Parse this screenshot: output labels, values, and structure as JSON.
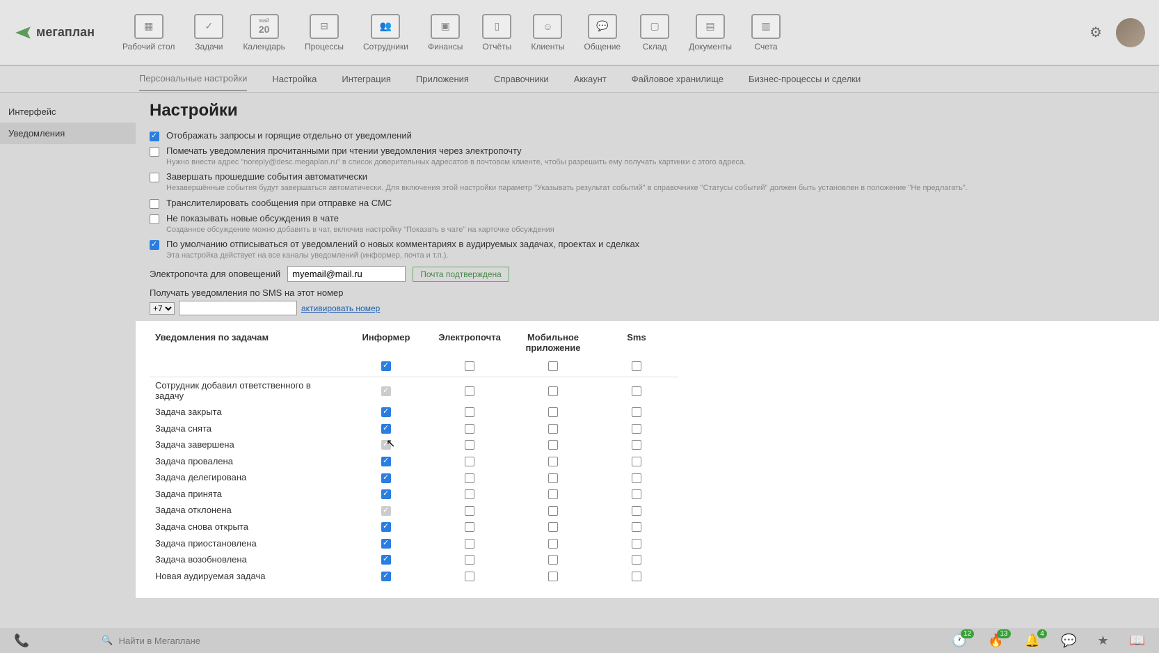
{
  "logo": "мегаплан",
  "nav": [
    {
      "label": "Рабочий стол",
      "icon": "dashboard"
    },
    {
      "label": "Задачи",
      "icon": "check"
    },
    {
      "label": "Календарь",
      "icon": "calendar",
      "num": "20",
      "sub": "май"
    },
    {
      "label": "Процессы",
      "icon": "flow"
    },
    {
      "label": "Сотрудники",
      "icon": "people"
    },
    {
      "label": "Финансы",
      "icon": "safe"
    },
    {
      "label": "Отчёты",
      "icon": "chart"
    },
    {
      "label": "Клиенты",
      "icon": "client"
    },
    {
      "label": "Общение",
      "icon": "chat"
    },
    {
      "label": "Склад",
      "icon": "box"
    },
    {
      "label": "Документы",
      "icon": "docs"
    },
    {
      "label": "Счета",
      "icon": "invoice"
    }
  ],
  "subnav": [
    "Персональные настройки",
    "Настройка",
    "Интеграция",
    "Приложения",
    "Справочники",
    "Аккаунт",
    "Файловое хранилище",
    "Бизнес-процессы и сделки"
  ],
  "subnav_active": 0,
  "sidebar": [
    "Интерфейс",
    "Уведомления"
  ],
  "sidebar_active": 1,
  "title": "Настройки",
  "opts": [
    {
      "checked": true,
      "label": "Отображать запросы и горящие отдельно от уведомлений"
    },
    {
      "checked": false,
      "label": "Помечать уведомления прочитанными при чтении уведомления через электропочту",
      "help": "Нужно внести адрес \"noreply@desc.megaplan.ru\" в список доверительных адресатов в почтовом клиенте, чтобы разрешить ему получать картинки с этого адреса."
    },
    {
      "checked": false,
      "disabled": true,
      "label": "Завершать прошедшие события автоматически",
      "help": "Незавершённые события будут завершаться автоматически.\nДля включения этой настройки параметр \"Указывать результат событий\" в справочнике \"Статусы событий\" должен быть установлен в положение \"Не предлагать\"."
    },
    {
      "checked": false,
      "label": "Транслителировать сообщения при отправке на СМС"
    },
    {
      "checked": false,
      "label": "Не показывать новые обсуждения в чате",
      "help": "Созданное обсуждение можно добавить в чат, включив настройку \"Показать в чате\" на карточке обсуждения"
    },
    {
      "checked": true,
      "label": "По умолчанию отписываться от уведомлений о новых комментариях в аудируемых задачах, проектах и сделках",
      "help": "Эта настройка действует на все каналы уведомлений (информер, почта и т.п.)."
    }
  ],
  "email_label": "Электропочта для оповещений",
  "email_value": "myemail@mail.ru",
  "email_badge": "Почта подтверждена",
  "sms_label": "Получать уведомления по SMS на этот номер",
  "sms_code": "+7",
  "sms_value": "",
  "sms_link": "активировать номер",
  "table": {
    "title": "Уведомления по задачам",
    "cols": [
      "Информер",
      "Электропочта",
      "Мобильное приложение",
      "Sms"
    ],
    "all": [
      true,
      false,
      false,
      false
    ],
    "rows": [
      {
        "label": "Сотрудник добавил ответственного в задачу",
        "cells": [
          "disabled",
          false,
          false,
          false
        ]
      },
      {
        "label": "Задача закрыта",
        "cells": [
          true,
          false,
          false,
          false
        ]
      },
      {
        "label": "Задача снята",
        "cells": [
          true,
          false,
          false,
          false
        ]
      },
      {
        "label": "Задача завершена",
        "cells": [
          "disabled",
          false,
          false,
          false
        ]
      },
      {
        "label": "Задача провалена",
        "cells": [
          true,
          false,
          false,
          false
        ]
      },
      {
        "label": "Задача делегирована",
        "cells": [
          true,
          false,
          false,
          false
        ]
      },
      {
        "label": "Задача принята",
        "cells": [
          true,
          false,
          false,
          false
        ]
      },
      {
        "label": "Задача отклонена",
        "cells": [
          "disabled",
          false,
          false,
          false
        ]
      },
      {
        "label": "Задача снова открыта",
        "cells": [
          true,
          false,
          false,
          false
        ]
      },
      {
        "label": "Задача приостановлена",
        "cells": [
          true,
          false,
          false,
          false
        ]
      },
      {
        "label": "Задача возобновлена",
        "cells": [
          true,
          false,
          false,
          false
        ]
      },
      {
        "label": "Новая аудируемая задача",
        "cells": [
          true,
          false,
          false,
          false
        ]
      }
    ]
  },
  "search_placeholder": "Найти в Мегаплане",
  "status": [
    {
      "icon": "clock",
      "count": "12"
    },
    {
      "icon": "fire",
      "count": "13"
    },
    {
      "icon": "bell",
      "count": "4"
    },
    {
      "icon": "msg"
    },
    {
      "icon": "star"
    },
    {
      "icon": "book"
    }
  ]
}
